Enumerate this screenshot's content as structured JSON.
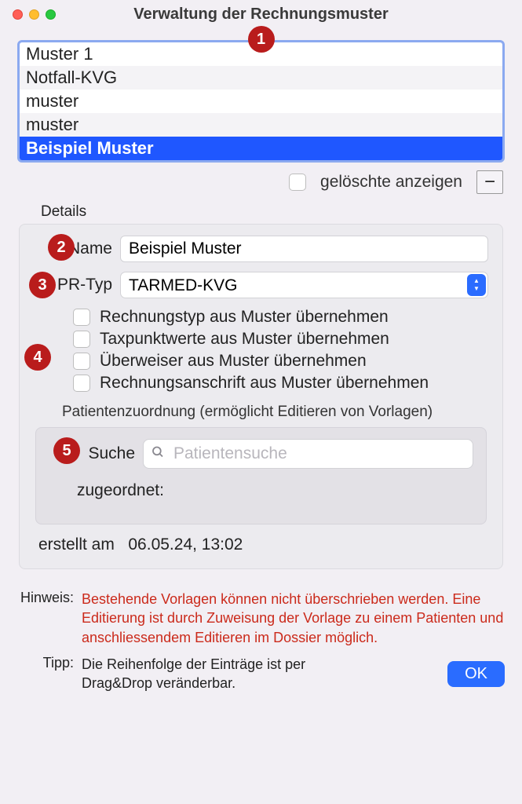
{
  "window": {
    "title": "Verwaltung der Rechnungsmuster"
  },
  "annotations": {
    "n1": "1",
    "n2": "2",
    "n3": "3",
    "n4": "4",
    "n5": "5"
  },
  "list": {
    "items": [
      {
        "label": "Muster 1"
      },
      {
        "label": "Notfall-KVG"
      },
      {
        "label": "muster"
      },
      {
        "label": "muster"
      },
      {
        "label": "Beispiel Muster"
      }
    ]
  },
  "under_list": {
    "show_deleted_label": "gelöschte anzeigen",
    "minus": "−"
  },
  "details": {
    "heading": "Details",
    "name_label": "Name",
    "name_value": "Beispiel Muster",
    "prtyp_label": "PR-Typ",
    "prtyp_value": "TARMED-KVG",
    "checks": [
      "Rechnungstyp aus Muster übernehmen",
      "Taxpunktwerte aus Muster übernehmen",
      "Überweiser aus Muster übernehmen",
      "Rechnungsanschrift aus Muster übernehmen"
    ],
    "assign_heading": "Patientenzuordnung (ermöglicht Editieren von Vorlagen)",
    "search_label": "Suche",
    "search_placeholder": "Patientensuche",
    "assigned_label": "zugeordnet:",
    "created_label": "erstellt am",
    "created_value": "06.05.24, 13:02"
  },
  "footer": {
    "hint_label": "Hinweis:",
    "hint_text": "Bestehende Vorlagen können nicht überschrieben werden. Eine Editierung ist durch Zuweisung der Vorlage zu einem Patienten und anschliessendem Editieren im Dossier möglich.",
    "tip_label": "Tipp:",
    "tip_text": "Die Reihenfolge der Einträge ist per Drag&Drop veränderbar.",
    "ok": "OK"
  }
}
